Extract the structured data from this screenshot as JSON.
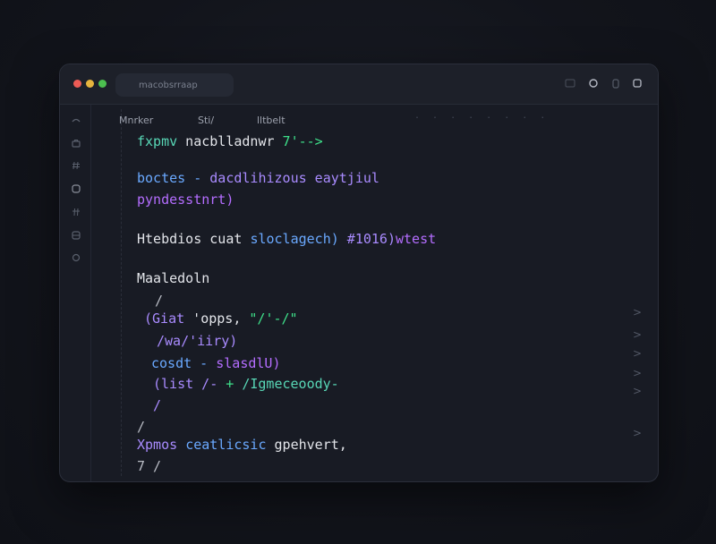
{
  "window": {
    "url_icon": "",
    "url_text": "macobsrraap"
  },
  "toolbar_icons": [
    "window-icon",
    "chat-bubble-icon",
    "lock-icon",
    "copy-icon"
  ],
  "sidebar_icons": [
    "layers-icon",
    "briefcase-icon",
    "hash-icon",
    "square-icon",
    "hash-icon",
    "database-icon",
    "search-icon"
  ],
  "tabs": [
    {
      "label": "Mnrker"
    },
    {
      "label": "Sti/"
    },
    {
      "label": "lltbelt"
    }
  ],
  "tab_separator": ". .   . .   . .   . .",
  "code": {
    "line1": {
      "a": "fxpmv",
      "b": " nacblladnwr",
      "c": " 7'-->"
    },
    "line2": {
      "a": "boctes - ",
      "b": "dacdlihizous eaytjiul"
    },
    "line3": {
      "a": "pyndesstnrt)"
    },
    "line4": {
      "a": "Htebdios cuat ",
      "b": "sloclagech)",
      "c": " #1016)",
      "d": "wtest"
    },
    "line5": {
      "a": "Maaledoln"
    },
    "line6": {
      "a": "/"
    },
    "line7": {
      "a": "(Giat",
      "b": " 'opps,",
      "c": " \"/'-/\""
    },
    "line8": {
      "a": "/wa/'iiry)"
    },
    "line9": {
      "a": "cosdt - ",
      "b": "slasdlU)"
    },
    "line10": {
      "a": "(list /- ",
      "b": "+ ",
      "c": "/Igmeceoody-"
    },
    "line11": {
      "a": "/"
    },
    "line12": {
      "a": "/"
    },
    "line13": {
      "a": "Xpmos ",
      "b": "ceatlicsic",
      "c": " gpehvert,"
    },
    "line14": {
      "a": "7 /"
    }
  },
  "chevrons": [
    ">",
    ">",
    ">",
    ">",
    ">",
    ">"
  ],
  "colors": {
    "teal": "#58d7b6",
    "green": "#3ee08a",
    "blue": "#6aa9ff",
    "violet": "#a98bff",
    "purple": "#b46dff"
  }
}
